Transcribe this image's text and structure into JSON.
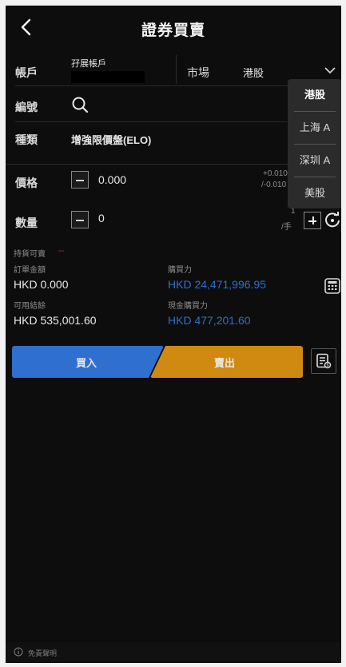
{
  "header": {
    "title": "證券買賣"
  },
  "account": {
    "label": "帳戶",
    "value": "孖展帳戶"
  },
  "market": {
    "label": "市場",
    "value": "港股"
  },
  "stock_code": {
    "label": "編號"
  },
  "order_type": {
    "label": "種類",
    "value": "增強限價盤(ELO)"
  },
  "price": {
    "label": "價格",
    "value": "0.000",
    "range_top": "+0.010",
    "range_bottom": "/-0.010"
  },
  "quantity": {
    "label": "數量",
    "value": "0",
    "lot_top": "1",
    "lot_unit": "/手"
  },
  "market_dropdown": {
    "options": [
      {
        "label": "港股",
        "selected": true
      },
      {
        "label": "上海 A",
        "selected": false
      },
      {
        "label": "深圳 A",
        "selected": false
      },
      {
        "label": "美股",
        "selected": false
      }
    ]
  },
  "holdings": {
    "label": "持貨可賣",
    "value": "--"
  },
  "order_amount": {
    "label": "訂單金額",
    "value": "HKD 0.000"
  },
  "buying_power": {
    "label": "購買力",
    "value": "HKD 24,471,996.95"
  },
  "available_balance": {
    "label": "可用結餘",
    "value": "HKD 535,001.60"
  },
  "cash_buying_power": {
    "label": "現金購買力",
    "value": "HKD 477,201.60"
  },
  "actions": {
    "buy_label": "買入",
    "sell_label": "賣出"
  },
  "footer": {
    "disclaimer": "免責聲明"
  },
  "colors": {
    "buy": "#2f6fce",
    "sell": "#d08a12",
    "accent_value": "#2f6fc7",
    "background": "#0d0d0d"
  },
  "icons": [
    "back-arrow-icon",
    "chevron-down-icon",
    "search-icon",
    "minus-icon",
    "plus-icon",
    "refresh-icon",
    "calculator-icon",
    "order-list-icon",
    "info-icon"
  ]
}
